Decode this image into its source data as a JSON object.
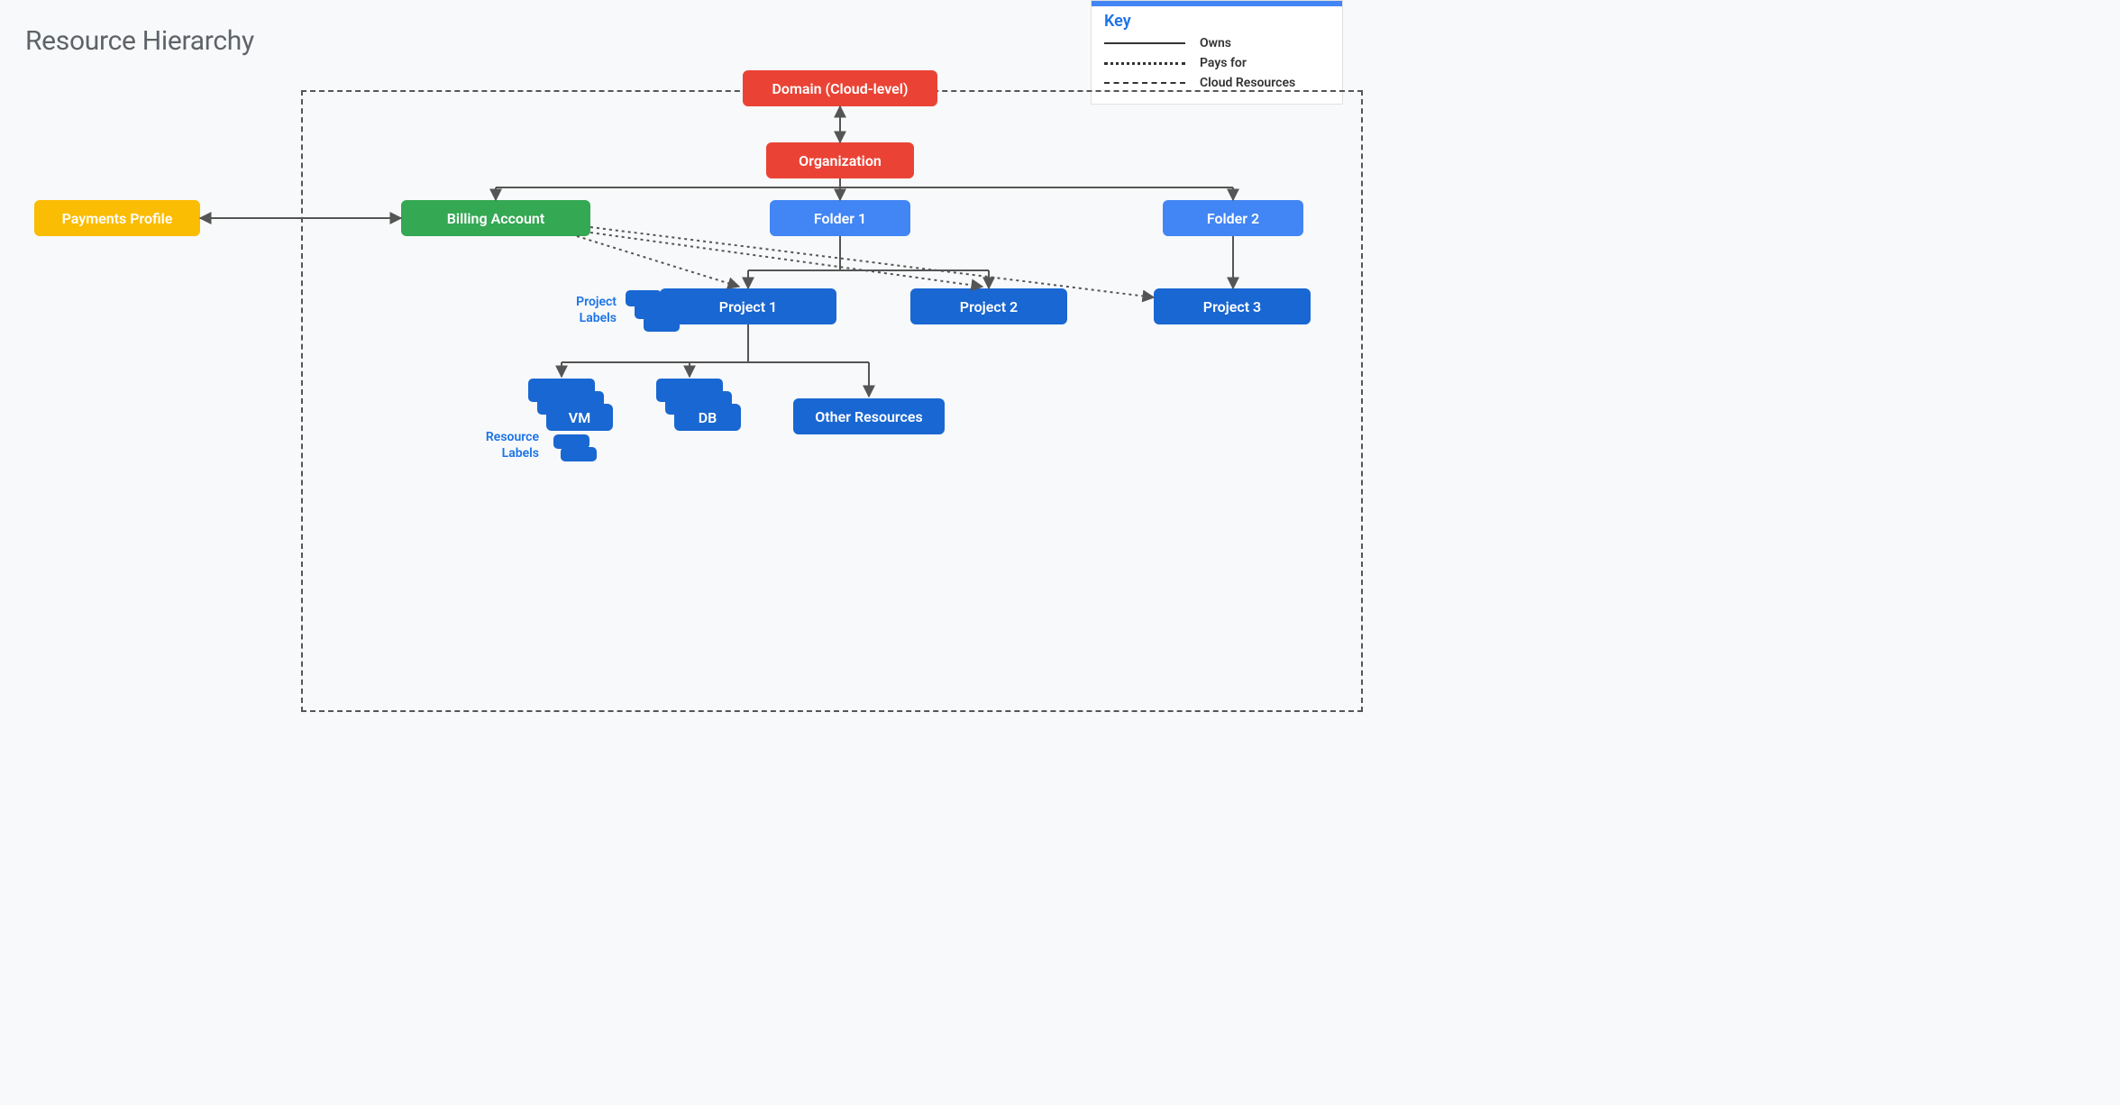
{
  "title": "Resource Hierarchy",
  "legend": {
    "heading": "Key",
    "owns": "Owns",
    "pays_for": "Pays for",
    "cloud_resources": "Cloud Resources"
  },
  "nodes": {
    "domain": "Domain (Cloud-level)",
    "organization": "Organization",
    "payments_profile": "Payments Profile",
    "billing_account": "Billing Account",
    "folder1": "Folder 1",
    "folder2": "Folder 2",
    "project1": "Project 1",
    "project2": "Project 2",
    "project3": "Project 3",
    "vm": "VM",
    "db": "DB",
    "other_resources": "Other Resources"
  },
  "labels": {
    "project_labels": "Project Labels",
    "project_labels_l1": "Project",
    "project_labels_l2": "Labels",
    "resource_labels": "Resource Labels",
    "resource_labels_l1": "Resource",
    "resource_labels_l2": "Labels"
  }
}
